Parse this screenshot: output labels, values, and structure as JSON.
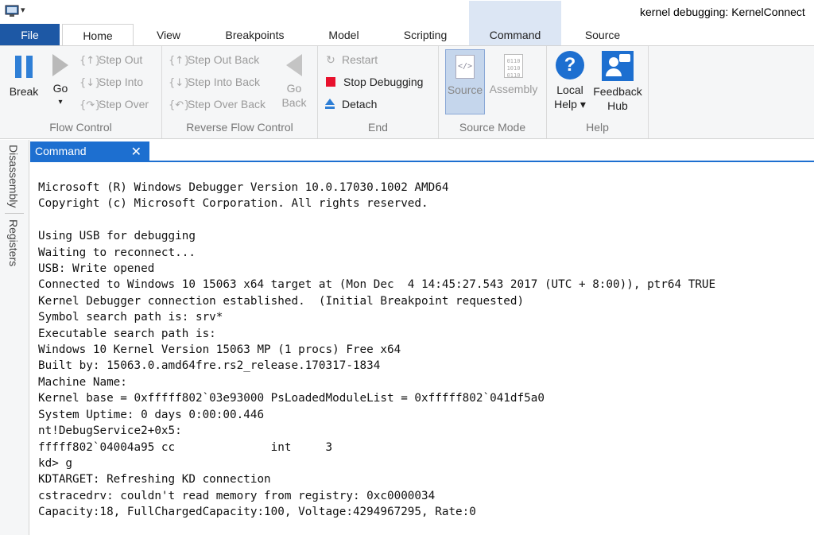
{
  "window": {
    "title": "kernel debugging: KernelConnect"
  },
  "tabs": {
    "file": "File",
    "home": "Home",
    "view": "View",
    "breakpoints": "Breakpoints",
    "model": "Model",
    "scripting": "Scripting",
    "command": "Command",
    "source": "Source"
  },
  "ribbon": {
    "flow_control": {
      "label": "Flow Control",
      "break": "Break",
      "go": "Go",
      "go_arrow": "▾",
      "step_out": "Step Out",
      "step_into": "Step Into",
      "step_over": "Step Over"
    },
    "reverse_flow": {
      "label": "Reverse Flow Control",
      "step_out_back": "Step Out Back",
      "step_into_back": "Step Into Back",
      "step_over_back": "Step Over Back",
      "go_back_1": "Go",
      "go_back_2": "Back"
    },
    "end": {
      "label": "End",
      "restart": "Restart",
      "stop_debugging": "Stop Debugging",
      "detach": "Detach"
    },
    "source_mode": {
      "label": "Source Mode",
      "source": "Source",
      "assembly": "Assembly"
    },
    "help": {
      "label": "Help",
      "local_help_1": "Local",
      "local_help_2": "Help ▾",
      "feedback_hub_1": "Feedback",
      "feedback_hub_2": "Hub"
    }
  },
  "side_panel": {
    "disassembly": "Disassembly",
    "registers": "Registers"
  },
  "command_pane": {
    "tab_label": "Command",
    "close_glyph": "✕",
    "output": "Microsoft (R) Windows Debugger Version 10.0.17030.1002 AMD64\nCopyright (c) Microsoft Corporation. All rights reserved.\n\nUsing USB for debugging\nWaiting to reconnect...\nUSB: Write opened\nConnected to Windows 10 15063 x64 target at (Mon Dec  4 14:45:27.543 2017 (UTC + 8:00)), ptr64 TRUE\nKernel Debugger connection established.  (Initial Breakpoint requested)\nSymbol search path is: srv*\nExecutable search path is:\nWindows 10 Kernel Version 15063 MP (1 procs) Free x64\nBuilt by: 15063.0.amd64fre.rs2_release.170317-1834\nMachine Name:\nKernel base = 0xfffff802`03e93000 PsLoadedModuleList = 0xfffff802`041df5a0\nSystem Uptime: 0 days 0:00:00.446\nnt!DebugService2+0x5:\nfffff802`04004a95 cc              int     3\nkd> g\nKDTARGET: Refreshing KD connection\ncstracedrv: couldn't read memory from registry: 0xc0000034\nCapacity:18, FullChargedCapacity:100, Voltage:4294967295, Rate:0"
  },
  "colors": {
    "accent": "#1d6fd0",
    "file_tab": "#1d58a5",
    "stop": "#e8112d"
  }
}
